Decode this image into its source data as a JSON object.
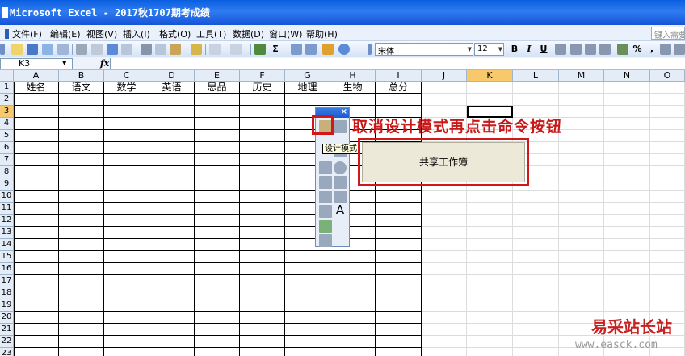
{
  "window": {
    "title": "Microsoft Excel - 2017秋1707期考成绩"
  },
  "menu": {
    "items": [
      "文件(F)",
      "编辑(E)",
      "视图(V)",
      "插入(I)",
      "格式(O)",
      "工具(T)",
      "数据(D)",
      "窗口(W)",
      "帮助(H)"
    ],
    "help_placeholder": "键入需要"
  },
  "toolbar": {
    "font_name": "宋体",
    "font_size": "12"
  },
  "formula_bar": {
    "name_box": "K3",
    "fx": "fx"
  },
  "columns": [
    "A",
    "B",
    "C",
    "D",
    "E",
    "F",
    "G",
    "H",
    "I",
    "J",
    "K",
    "L",
    "M",
    "N",
    "O"
  ],
  "active_column": "K",
  "active_row": "3",
  "rows": [
    "1",
    "2",
    "3",
    "4",
    "5",
    "6",
    "7",
    "8",
    "9",
    "10",
    "11",
    "12",
    "13",
    "14",
    "15",
    "16",
    "17",
    "18",
    "19",
    "20",
    "21",
    "22",
    "23"
  ],
  "table_headers": [
    "姓名",
    "语文",
    "数学",
    "英语",
    "思品",
    "历史",
    "地理",
    "生物",
    "总分"
  ],
  "toolbox": {
    "tooltip": "设计模式"
  },
  "annotation": "取消设计模式再点击命令按钮",
  "command_button": {
    "label": "共享工作簿"
  },
  "watermark": {
    "text": "易采站长站",
    "url": "www.easck.com"
  },
  "colors": {
    "title_bar": "#1554d8",
    "annotation_red": "#c81818",
    "active_header": "#f8c96a"
  }
}
